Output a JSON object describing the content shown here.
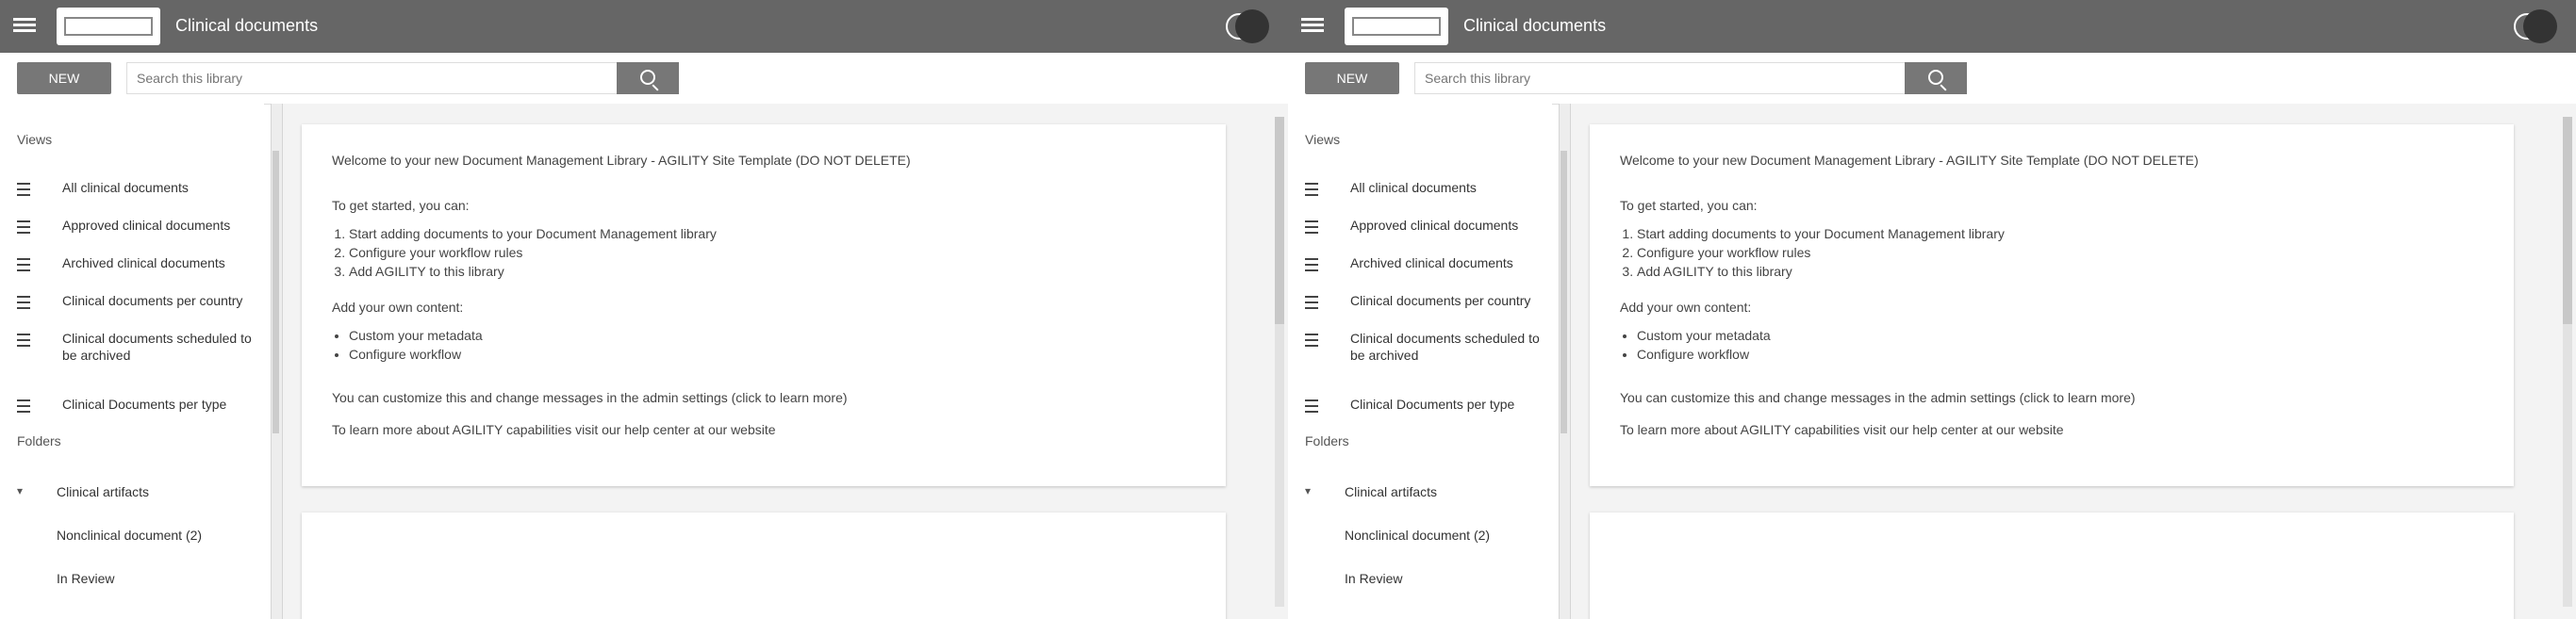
{
  "panes": [
    {
      "header": {
        "title": "Clinical documents"
      },
      "actions": {
        "new_label": "NEW",
        "search_placeholder": "Search this library"
      },
      "sidebar": {
        "views_label": "Views",
        "items": [
          "All clinical documents",
          "Approved clinical documents",
          "Archived clinical documents",
          "Clinical documents per country",
          "Clinical documents scheduled to be archived",
          "Clinical Documents per type"
        ],
        "folders_label": "Folders",
        "folders": [
          "Clinical artifacts",
          "Nonclinical document (2)",
          "In Review"
        ]
      },
      "card": {
        "welcome": "Welcome to your new Document Management Library - AGILITY Site Template (DO NOT DELETE)",
        "to_get_started": "To get started, you can:",
        "steps": [
          "Start adding documents to your Document Management library",
          "Configure your workflow rules",
          "Add AGILITY to this library"
        ],
        "add_text": "Add your own content:",
        "bullets": [
          "Custom your metadata",
          "Configure workflow"
        ],
        "note1": "You can customize this and change messages in the admin settings (click to learn more)",
        "note2": "To learn more about AGILITY capabilities visit our help center at our website"
      }
    },
    {
      "header": {
        "title": "Clinical documents"
      },
      "actions": {
        "new_label": "NEW",
        "search_placeholder": "Search this library"
      },
      "sidebar": {
        "views_label": "Views",
        "items": [
          "All clinical documents",
          "Approved clinical documents",
          "Archived clinical documents",
          "Clinical documents per country",
          "Clinical documents scheduled to be archived",
          "Clinical Documents per type"
        ],
        "folders_label": "Folders",
        "folders": [
          "Clinical artifacts",
          "Nonclinical document (2)",
          "In Review"
        ]
      },
      "card": {
        "welcome": "Welcome to your new Document Management Library - AGILITY Site Template (DO NOT DELETE)",
        "to_get_started": "To get started, you can:",
        "steps": [
          "Start adding documents to your Document Management library",
          "Configure your workflow rules",
          "Add AGILITY to this library"
        ],
        "add_text": "Add your own content:",
        "bullets": [
          "Custom your metadata",
          "Configure workflow"
        ],
        "note1": "You can customize this and change messages in the admin settings (click to learn more)",
        "note2": "To learn more about AGILITY capabilities visit our help center at our website"
      }
    }
  ]
}
